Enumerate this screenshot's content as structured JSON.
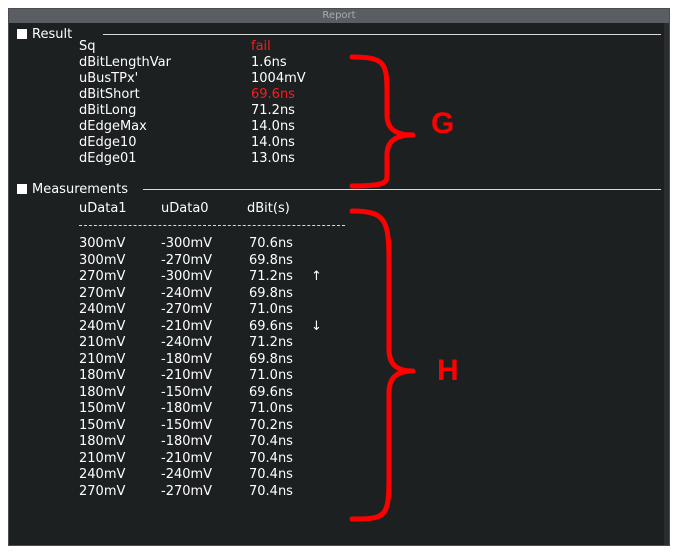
{
  "window": {
    "title": "Report"
  },
  "result": {
    "header": "Result",
    "items": [
      {
        "name": "Sq",
        "value": "fail",
        "fail": true
      },
      {
        "name": "dBitLengthVar",
        "value": "1.6ns",
        "fail": false
      },
      {
        "name": "uBusTPx'",
        "value": "1004mV",
        "fail": false
      },
      {
        "name": "dBitShort",
        "value": "69.6ns",
        "fail": true
      },
      {
        "name": "dBitLong",
        "value": "71.2ns",
        "fail": false
      },
      {
        "name": "dEdgeMax",
        "value": "14.0ns",
        "fail": false
      },
      {
        "name": "dEdge10",
        "value": "14.0ns",
        "fail": false
      },
      {
        "name": "dEdge01",
        "value": "13.0ns",
        "fail": false
      }
    ]
  },
  "measurements": {
    "header": "Measurements",
    "columns": [
      "uData1",
      "uData0",
      "dBit(s)"
    ],
    "rows": [
      [
        "300mV",
        "-300mV",
        "70.6ns",
        ""
      ],
      [
        "300mV",
        "-270mV",
        "69.8ns",
        ""
      ],
      [
        "270mV",
        "-300mV",
        "71.2ns",
        "↑"
      ],
      [
        "270mV",
        "-240mV",
        "69.8ns",
        ""
      ],
      [
        "240mV",
        "-270mV",
        "71.0ns",
        ""
      ],
      [
        "240mV",
        "-210mV",
        "69.6ns",
        "↓"
      ],
      [
        "210mV",
        "-240mV",
        "71.2ns",
        ""
      ],
      [
        "210mV",
        "-180mV",
        "69.8ns",
        ""
      ],
      [
        "180mV",
        "-210mV",
        "71.0ns",
        ""
      ],
      [
        "180mV",
        "-150mV",
        "69.6ns",
        ""
      ],
      [
        "150mV",
        "-180mV",
        "71.0ns",
        ""
      ],
      [
        "150mV",
        "-150mV",
        "70.2ns",
        ""
      ],
      [
        "180mV",
        "-180mV",
        "70.4ns",
        ""
      ],
      [
        "210mV",
        "-210mV",
        "70.4ns",
        ""
      ],
      [
        "240mV",
        "-240mV",
        "70.4ns",
        ""
      ],
      [
        "270mV",
        "-270mV",
        "70.4ns",
        ""
      ]
    ]
  },
  "annotations": {
    "g_label": "G",
    "h_label": "H",
    "color": "#ff0000"
  },
  "colors": {
    "fail": "#ff1a1a",
    "text": "#ffffff",
    "background": "#1c2021"
  }
}
